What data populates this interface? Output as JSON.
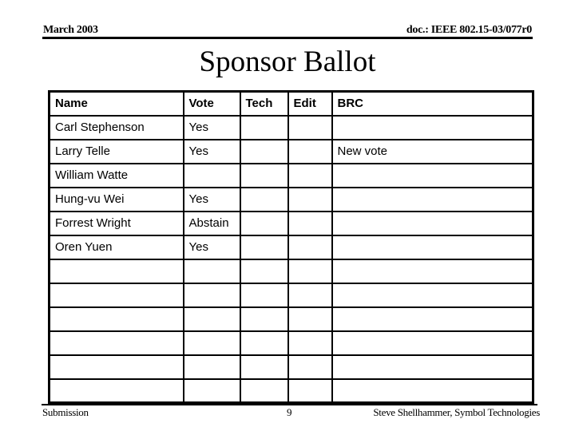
{
  "header": {
    "date": "March 2003",
    "doc_id": "doc.: IEEE 802.15-03/077r0"
  },
  "title": "Sponsor Ballot",
  "table": {
    "columns": [
      "Name",
      "Vote",
      "Tech",
      "Edit",
      "BRC"
    ],
    "rows": [
      [
        "Carl Stephenson",
        "Yes",
        "",
        "",
        ""
      ],
      [
        "Larry Telle",
        "Yes",
        "",
        "",
        "New vote"
      ],
      [
        "William Watte",
        "",
        "",
        "",
        ""
      ],
      [
        "Hung-vu Wei",
        "Yes",
        "",
        "",
        ""
      ],
      [
        "Forrest Wright",
        "Abstain",
        "",
        "",
        ""
      ],
      [
        "Oren Yuen",
        "Yes",
        "",
        "",
        ""
      ],
      [
        "",
        "",
        "",
        "",
        ""
      ],
      [
        "",
        "",
        "",
        "",
        ""
      ],
      [
        "",
        "",
        "",
        "",
        ""
      ],
      [
        "",
        "",
        "",
        "",
        ""
      ],
      [
        "",
        "",
        "",
        "",
        ""
      ],
      [
        "",
        "",
        "",
        "",
        ""
      ]
    ]
  },
  "footer": {
    "left": "Submission",
    "page_number": "9",
    "author": "Steve Shellhammer, Symbol Technologies"
  }
}
